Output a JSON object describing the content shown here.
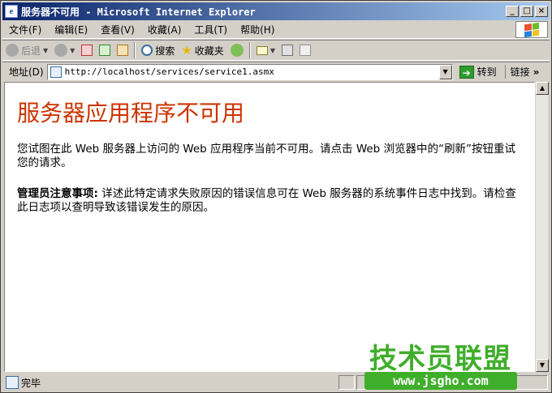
{
  "window": {
    "title": "服务器不可用 - Microsoft Internet Explorer",
    "controls": {
      "minimize": "_",
      "maximize": "□",
      "close": "×"
    }
  },
  "menu": {
    "items": [
      "文件(F)",
      "编辑(E)",
      "查看(V)",
      "收藏(A)",
      "工具(T)",
      "帮助(H)"
    ]
  },
  "toolbar": {
    "back_label": "后退",
    "search_label": "搜索",
    "favorites_label": "收藏夹"
  },
  "address": {
    "label": "地址(D)",
    "url": "http://localhost/services/service1.asmx",
    "go_label": "转到",
    "links_label": "链接"
  },
  "page": {
    "heading": "服务器应用程序不可用",
    "paragraph1": "您试图在此 Web 服务器上访问的 Web 应用程序当前不可用。请点击 Web 浏览器中的“刷新”按钮重试您的请求。",
    "admin_note_label": "管理员注意事项:",
    "admin_note_text": " 详述此特定请求失败原因的错误信息可在 Web 服务器的系统事件日志中找到。请检查此日志项以查明导致该错误发生的原因。"
  },
  "status": {
    "text": "完毕"
  },
  "watermark": {
    "title": "技术员联盟",
    "url": "www.jsgho.com"
  },
  "colors": {
    "title_bar_start": "#0a246a",
    "title_bar_end": "#a6caf0",
    "heading": "#cc3300",
    "watermark": "#3fae2a"
  }
}
